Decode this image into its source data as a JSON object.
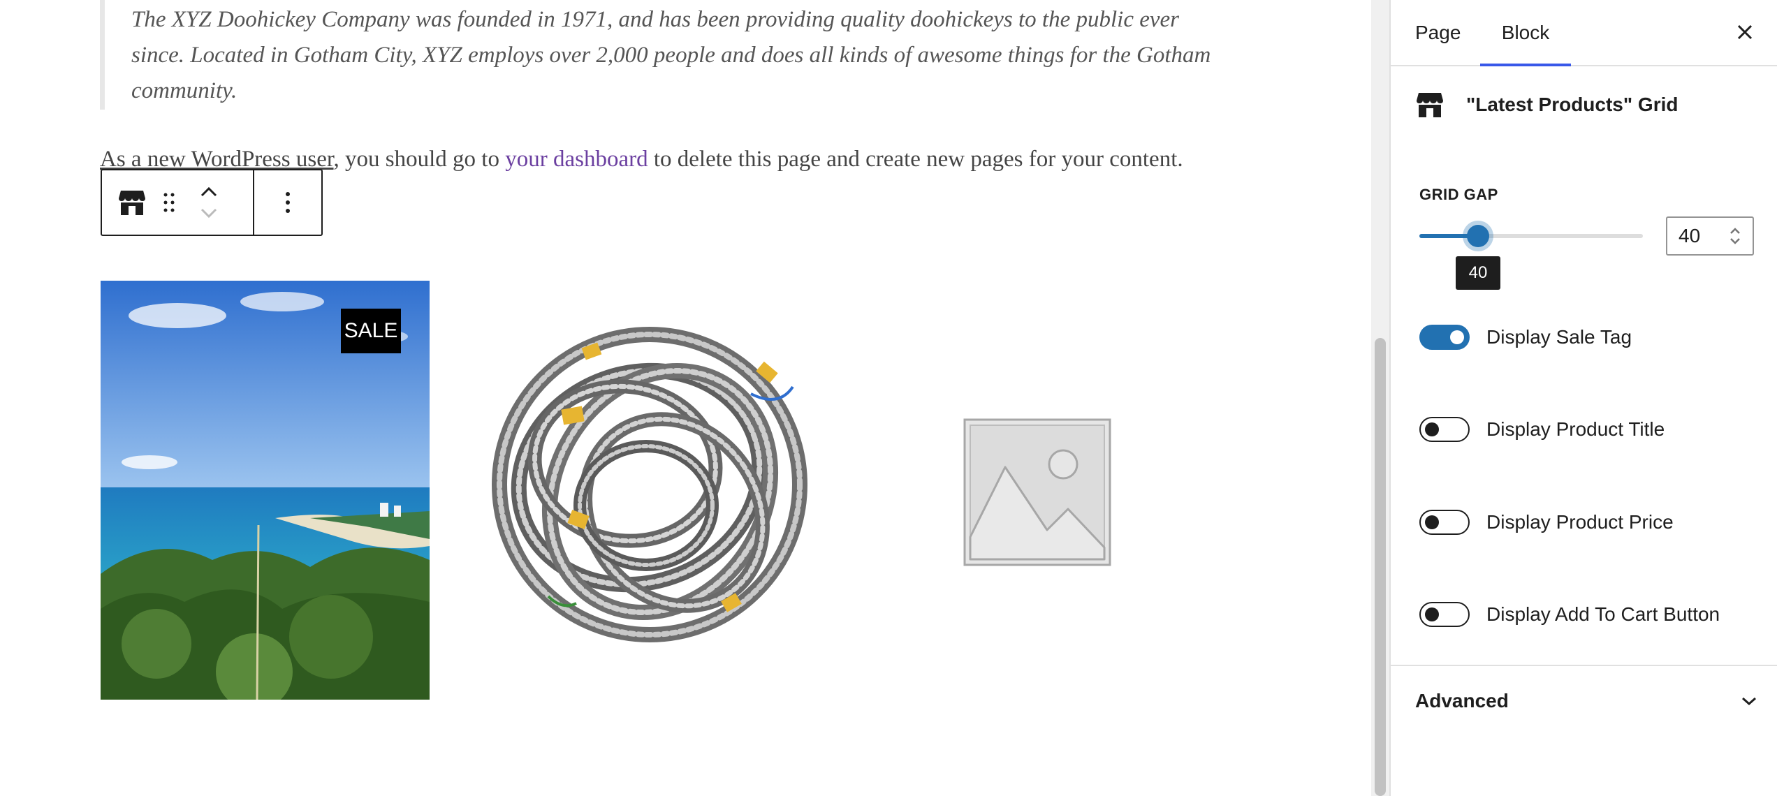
{
  "content": {
    "quote_text": "The XYZ Doohickey Company was founded in 1971, and has been providing quality doohickeys to the public ever since. Located in Gotham City, XYZ employs over 2,000 people and does all kinds of awesome things for the Gotham community.",
    "intro_prefix": "As a new WordPress user",
    "intro_middle": ", you should go to ",
    "intro_link": "your dashboard",
    "intro_suffix": " to delete this page and create new pages for your content."
  },
  "block_toolbar": {
    "icons": [
      "store-icon",
      "drag-handle-icon",
      "chevron-up-icon",
      "chevron-down-icon",
      "more-vertical-icon"
    ]
  },
  "products": [
    {
      "image": "beach-landscape",
      "sale_tag": "SALE"
    },
    {
      "image": "coiled-conduit-cable"
    },
    {
      "image": "placeholder-image"
    }
  ],
  "sidebar": {
    "tabs": [
      "Page",
      "Block"
    ],
    "active_tab": "Block",
    "block_name": "\"Latest Products\" Grid",
    "grid_gap": {
      "label": "GRID GAP",
      "value": "40",
      "tooltip": "40",
      "slider_fraction": 0.2
    },
    "toggles": [
      {
        "label": "Display Sale Tag",
        "on": true
      },
      {
        "label": "Display Product Title",
        "on": false
      },
      {
        "label": "Display Product Price",
        "on": false
      },
      {
        "label": "Display Add To Cart Button",
        "on": false
      }
    ],
    "advanced_label": "Advanced"
  },
  "colors": {
    "accent": "#2271b1",
    "tab_indicator": "#3858e9",
    "link": "#6b3fa0"
  }
}
